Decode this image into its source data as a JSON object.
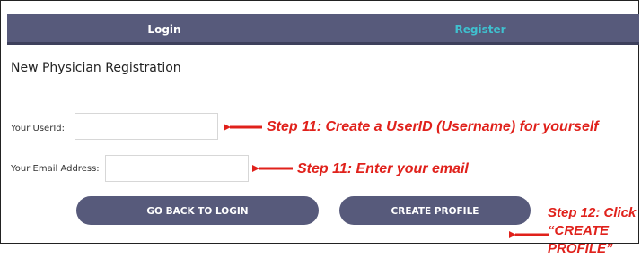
{
  "tabs": {
    "login": "Login",
    "register": "Register"
  },
  "form": {
    "title": "New Physician Registration",
    "userid_label": "Your UserId:",
    "userid_value": "",
    "email_label": "Your Email Address:",
    "email_value": ""
  },
  "buttons": {
    "back": "GO BACK TO LOGIN",
    "create": "CREATE PROFILE"
  },
  "annotations": {
    "step_userid": "Step 11: Create a UserID (Username) for yourself",
    "step_email": "Step 11: Enter your email",
    "step_create": "Step 12: Click “CREATE PROFILE”"
  },
  "colors": {
    "header_bg": "#575a7b",
    "active_tab": "#3fc0cf",
    "annotation": "#e0211b"
  }
}
